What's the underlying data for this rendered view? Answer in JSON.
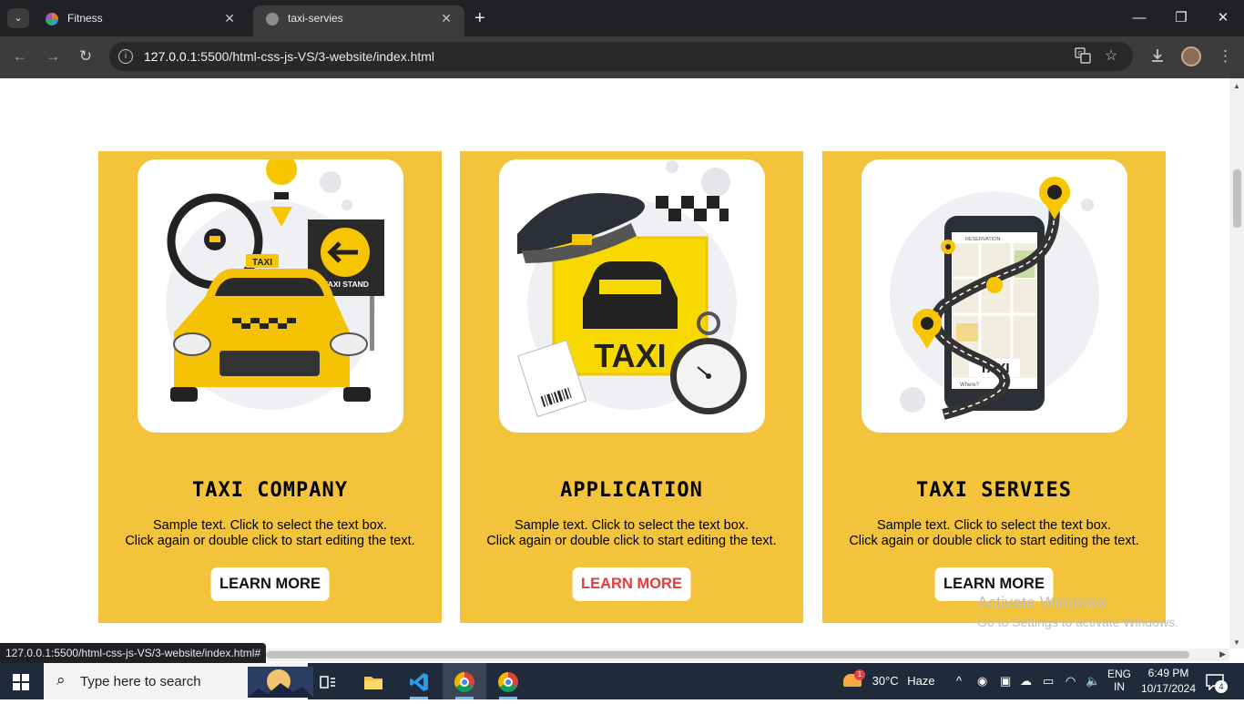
{
  "browser": {
    "tabs": [
      {
        "title": "Fitness",
        "active": false
      },
      {
        "title": "taxi-servies",
        "active": true
      }
    ],
    "new_tab": "+",
    "url_host": "127.0.0.1",
    "url_path": ":5500/html-css-js-VS/3-website/index.html",
    "status_url": "127.0.0.1:5500/html-css-js-VS/3-website/index.html#"
  },
  "cards": [
    {
      "heading": "TAXI COMPANY",
      "desc_line1": "Sample text. Click to select the text box.",
      "desc_line2": "Click again or double click to start editing the text.",
      "button": "LEARN MORE",
      "art_sign_label": "TAXI STAND",
      "art_roof_label": "TAXI"
    },
    {
      "heading": "APPLICATION",
      "desc_line1": "Sample text. Click to select the text box.",
      "desc_line2": "Click again or double click to start editing the text.",
      "button": "LEARN MORE",
      "art_label": "TAXI"
    },
    {
      "heading": "TAXI SERVIES",
      "desc_line1": "Sample text. Click to select the text box.",
      "desc_line2": "Click again or double click to start editing the text.",
      "button": "LEARN MORE",
      "art_label": "TAXI",
      "art_phone_header": "RESERVATION",
      "art_phone_footer": "Where?"
    }
  ],
  "watermark": {
    "line1": "Activate Windows",
    "line2": "Go to Settings to activate Windows."
  },
  "taskbar": {
    "search_placeholder": "Type here to search",
    "weather_temp": "30°C",
    "weather_desc": "Haze",
    "weather_badge": "1",
    "lang_top": "ENG",
    "lang_bottom": "IN",
    "time": "6:49 PM",
    "date": "10/17/2024",
    "notification_count": "4"
  },
  "colors": {
    "card_bg": "#f4c33c",
    "accent_red": "#e33b3b",
    "tab_bg": "#202124",
    "toolbar_bg": "#3c3c3c",
    "taskbar_bg": "#1f2a3a"
  }
}
